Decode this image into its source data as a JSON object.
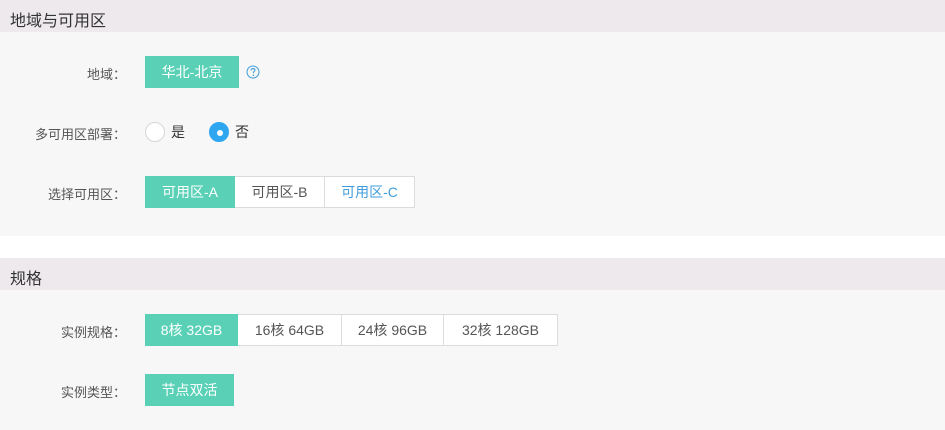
{
  "region_section": {
    "title": "地域与可用区",
    "region": {
      "label": "地域：",
      "value": "华北-北京"
    },
    "multi_az": {
      "label": "多可用区部署：",
      "options": [
        "是",
        "否"
      ],
      "selected": "否"
    },
    "az": {
      "label": "选择可用区：",
      "options": [
        "可用区-A",
        "可用区-B",
        "可用区-C"
      ],
      "selected": "可用区-A"
    }
  },
  "spec_section": {
    "title": "规格",
    "instance_spec": {
      "label": "实例规格：",
      "options": [
        "8核 32GB",
        "16核 64GB",
        "24核 96GB",
        "32核 128GB"
      ],
      "selected": "8核 32GB"
    },
    "instance_type": {
      "label": "实例类型：",
      "value": "节点双活"
    }
  },
  "colors": {
    "accent": "#5ad1b6",
    "radio_checked": "#2ea6f0",
    "link": "#3f9ddb",
    "header_bg": "#ede9ed",
    "body_bg": "#f7f7f7"
  },
  "icons": {
    "help": "question-circle-icon"
  }
}
